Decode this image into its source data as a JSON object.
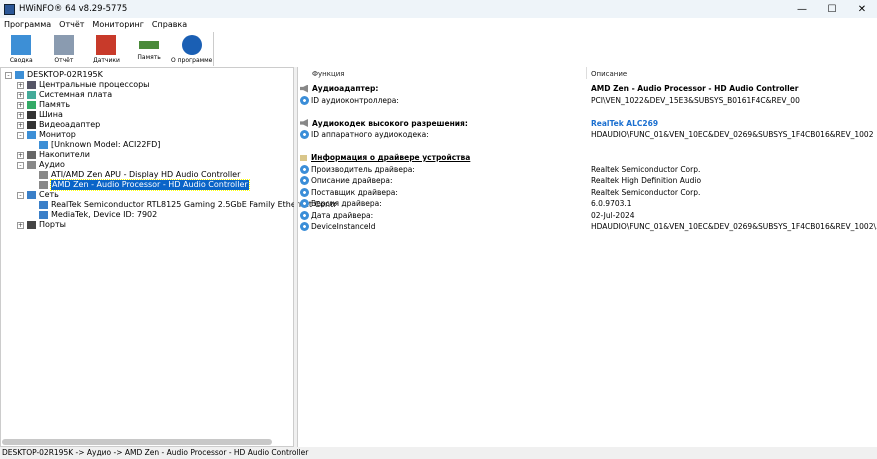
{
  "window": {
    "title": "HWiNFO® 64 v8.29-5775"
  },
  "menu": [
    "Программа",
    "Отчёт",
    "Мониторинг",
    "Справка"
  ],
  "toolbar": [
    {
      "label": "Сводка",
      "icon": "monitor-icon"
    },
    {
      "label": "Отчёт",
      "icon": "floppy-icon"
    },
    {
      "label": "Датчики",
      "icon": "thermometer-icon"
    },
    {
      "label": "Память",
      "icon": "memory-icon"
    },
    {
      "label": "О программе",
      "icon": "info-icon"
    }
  ],
  "tree": [
    {
      "label": "DESKTOP-02R195K",
      "level": 0,
      "exp": "-"
    },
    {
      "label": "Центральные процессоры",
      "level": 1,
      "exp": "+"
    },
    {
      "label": "Системная плата",
      "level": 1,
      "exp": "+"
    },
    {
      "label": "Память",
      "level": 1,
      "exp": "+"
    },
    {
      "label": "Шина",
      "level": 1,
      "exp": "+"
    },
    {
      "label": "Видеоадаптер",
      "level": 1,
      "exp": "+"
    },
    {
      "label": "Монитор",
      "level": 1,
      "exp": "-"
    },
    {
      "label": "[Unknown Model: ACI22FD]",
      "level": 2,
      "exp": ""
    },
    {
      "label": "Накопители",
      "level": 1,
      "exp": "+"
    },
    {
      "label": "Аудио",
      "level": 1,
      "exp": "-"
    },
    {
      "label": "ATI/AMD Zen APU - Display HD Audio Controller",
      "level": 2,
      "exp": ""
    },
    {
      "label": "AMD Zen - Audio Processor - HD Audio Controller",
      "level": 2,
      "exp": "",
      "selected": true
    },
    {
      "label": "Сеть",
      "level": 1,
      "exp": "-"
    },
    {
      "label": "RealTek Semiconductor RTL8125 Gaming 2.5GbE Family Ethernet Contr",
      "level": 2,
      "exp": ""
    },
    {
      "label": "MediaTek, Device ID: 7902",
      "level": 2,
      "exp": ""
    },
    {
      "label": "Порты",
      "level": 1,
      "exp": "+"
    }
  ],
  "details": {
    "col_function": "Функция",
    "col_description": "Описание",
    "rows": [
      {
        "f": "Аудиоадаптер:",
        "d": "AMD Zen - Audio Processor - HD Audio Controller",
        "type": "header"
      },
      {
        "f": "ID аудиоконтроллера:",
        "d": "PCI\\VEN_1022&DEV_15E3&SUBSYS_B0161F4C&REV_00",
        "type": "item"
      },
      {
        "f": "",
        "d": "",
        "type": "blank"
      },
      {
        "f": "Аудиокодек высокого разрешения:",
        "d": "RealTek ALC269",
        "type": "header",
        "link": true
      },
      {
        "f": "ID аппаратного аудиокодека:",
        "d": "HDAUDIO\\FUNC_01&VEN_10EC&DEV_0269&SUBSYS_1F4CB016&REV_1002",
        "type": "item"
      },
      {
        "f": "",
        "d": "",
        "type": "blank"
      },
      {
        "f": "Информация о драйвере устройства",
        "d": "",
        "type": "section"
      },
      {
        "f": "Производитель драйвера:",
        "d": "Realtek Semiconductor Corp.",
        "type": "item"
      },
      {
        "f": "Описание драйвера:",
        "d": "Realtek High Definition Audio",
        "type": "item"
      },
      {
        "f": "Поставщик драйвера:",
        "d": "Realtek Semiconductor Corp.",
        "type": "item"
      },
      {
        "f": "Версия драйвера:",
        "d": "6.0.9703.1",
        "type": "item"
      },
      {
        "f": "Дата драйвера:",
        "d": "02-Jul-2024",
        "type": "item"
      },
      {
        "f": "DeviceInstanceId",
        "d": "HDAUDIO\\FUNC_01&VEN_10EC&DEV_0269&SUBSYS_1F4CB016&REV_1002\\...",
        "type": "item"
      }
    ]
  },
  "status": "DESKTOP-02R195K -> Аудио -> AMD Zen - Audio Processor - HD Audio Controller",
  "colors": {
    "selection": "#0a64c8",
    "link": "#1a6fd0"
  }
}
